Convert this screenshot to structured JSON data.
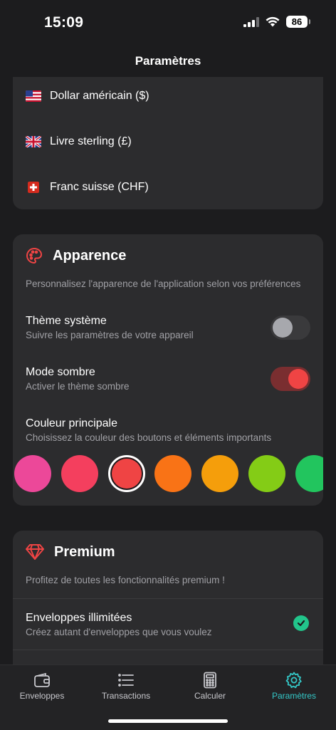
{
  "status_bar": {
    "time": "15:09",
    "battery": "86"
  },
  "header": {
    "title": "Paramètres"
  },
  "currencies": {
    "items": [
      {
        "label": "Dollar américain ($)",
        "flag": "us-flag-icon"
      },
      {
        "label": "Livre sterling (£)",
        "flag": "uk-flag-icon"
      },
      {
        "label": "Franc suisse (CHF)",
        "flag": "swiss-flag-icon"
      }
    ]
  },
  "appearance": {
    "title": "Apparence",
    "icon": "palette-icon",
    "description": "Personnalisez l'apparence de l'application selon vos préférences",
    "system_theme": {
      "label": "Thème système",
      "sub": "Suivre les paramètres de votre appareil",
      "enabled": false
    },
    "dark_mode": {
      "label": "Mode sombre",
      "sub": "Activer le thème sombre",
      "enabled": true
    },
    "main_color": {
      "label": "Couleur principale",
      "sub": "Choisissez la couleur des boutons et éléments importants",
      "selected_index": 2,
      "swatches": [
        "#ec4899",
        "#f43f5e",
        "#ef4444",
        "#f97316",
        "#f59e0b",
        "#84cc16",
        "#22c55e"
      ]
    }
  },
  "premium": {
    "title": "Premium",
    "icon": "diamond-icon",
    "description": "Profitez de toutes les fonctionnalités premium !",
    "features": [
      {
        "label": "Enveloppes illimitées",
        "sub": "Créez autant d'enveloppes que vous voulez",
        "included": true
      }
    ]
  },
  "tab_bar": {
    "active_color": "#34c8c8",
    "tabs": [
      {
        "label": "Enveloppes",
        "icon": "wallet-icon",
        "active": false
      },
      {
        "label": "Transactions",
        "icon": "list-icon",
        "active": false
      },
      {
        "label": "Calculer",
        "icon": "calculator-icon",
        "active": false
      },
      {
        "label": "Paramètres",
        "icon": "gear-icon",
        "active": true
      }
    ]
  }
}
